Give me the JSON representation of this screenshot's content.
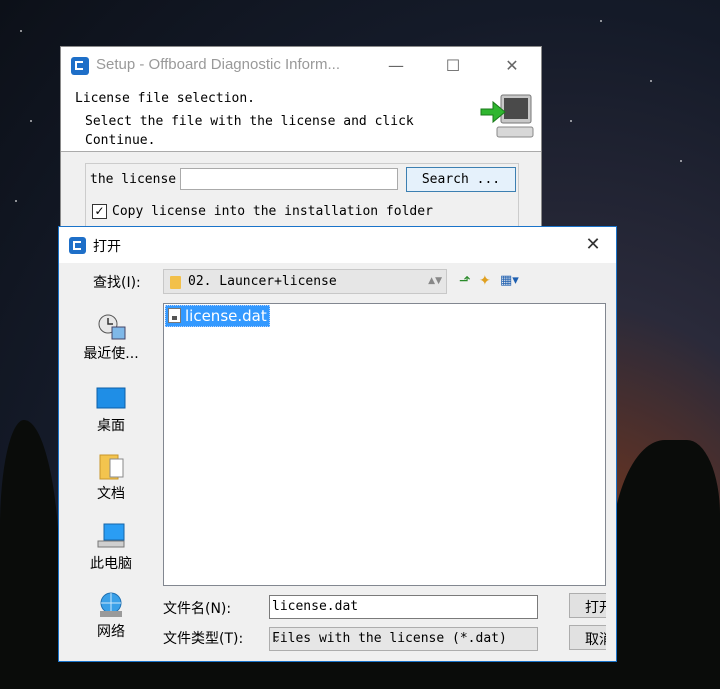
{
  "setup_window": {
    "title": "Setup - Offboard Diagnostic Inform...",
    "minimize": "—",
    "maximize": "☐",
    "close": "✕",
    "heading": "License file selection.",
    "instruction": "Select the file with the license and click Continue.",
    "license_label": "the license",
    "license_value": "",
    "search_button": "Search ...",
    "copy_checkbox_checked": true,
    "copy_checkbox_mark": "✓",
    "copy_checkbox_label": "Copy license into the installation folder"
  },
  "open_dialog": {
    "title": "打开",
    "close": "✕",
    "look_in_label": "查找(I):",
    "look_in_value": "02. Launcer+license",
    "toolbar_icons": [
      "up-folder-icon",
      "new-folder-icon",
      "view-menu-icon"
    ],
    "places": [
      {
        "label": "最近使...",
        "icon": "recent-icon"
      },
      {
        "label": "桌面",
        "icon": "desktop-icon"
      },
      {
        "label": "文档",
        "icon": "documents-icon"
      },
      {
        "label": "此电脑",
        "icon": "computer-icon"
      },
      {
        "label": "网络",
        "icon": "network-icon"
      }
    ],
    "files": [
      {
        "name": "license.dat",
        "selected": true
      }
    ],
    "file_name_label": "文件名(N):",
    "file_name_value": "license.dat",
    "file_type_label": "文件类型(T):",
    "file_type_value": "Files with the license (*.dat)",
    "open_button": "打开",
    "cancel_button": "取消"
  },
  "colors": {
    "accent": "#1a73c9",
    "selection": "#3399ff",
    "search_button_bg": "#e5f1fb"
  }
}
